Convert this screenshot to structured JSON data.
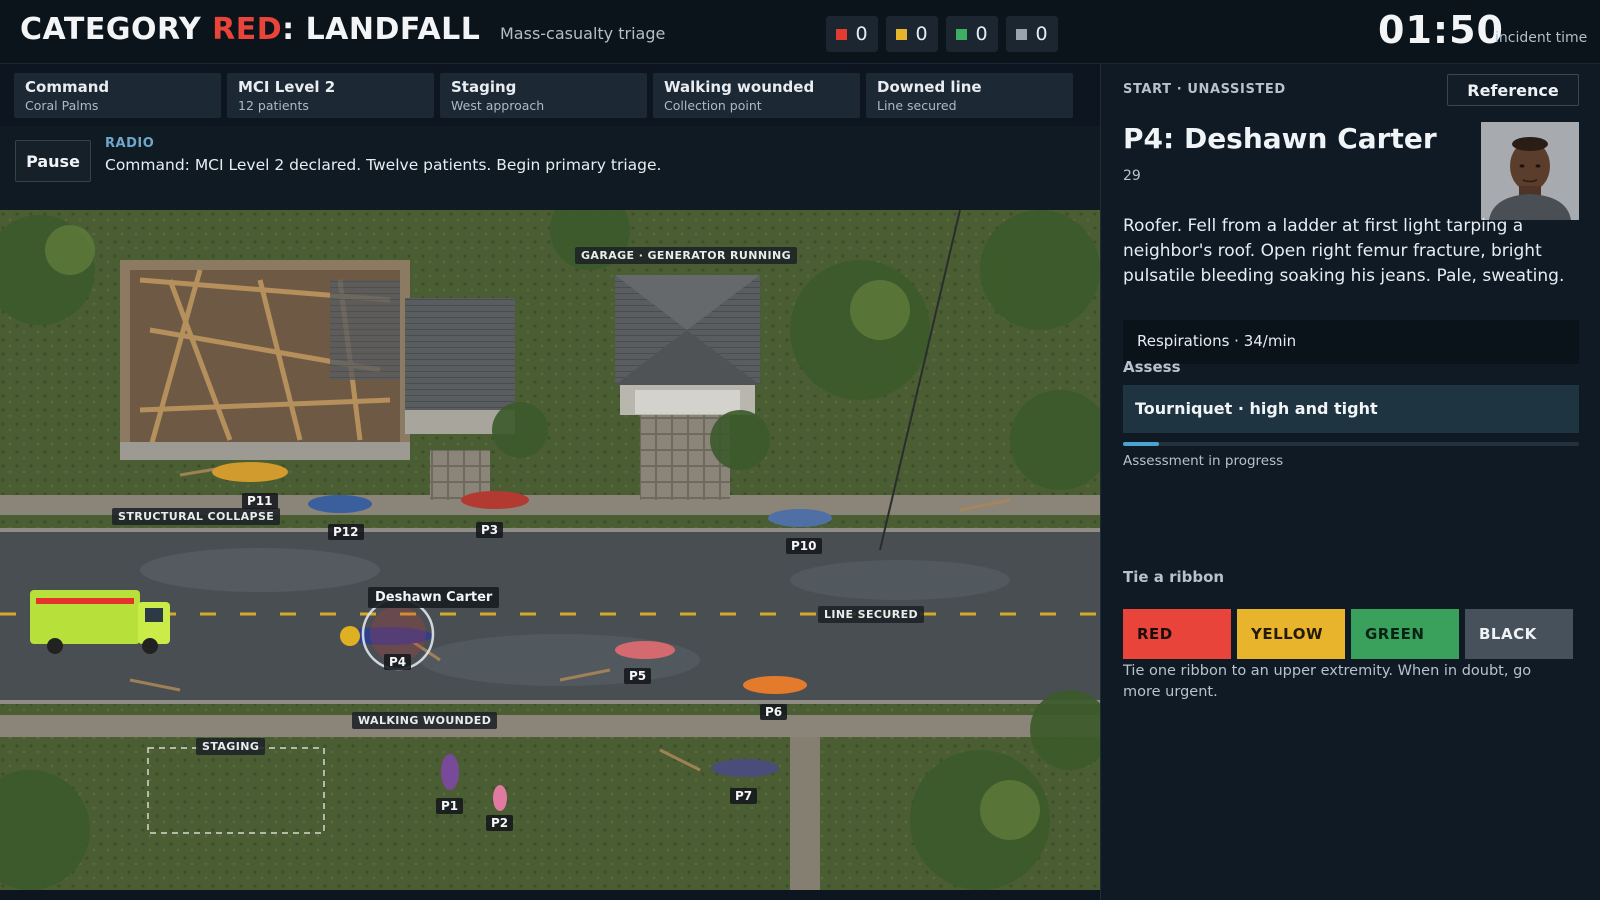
{
  "header": {
    "title_prefix": "CATEGORY ",
    "title_red": "RED",
    "title_suffix": ": LANDFALL",
    "subtitle": "Mass-casualty triage",
    "tallies": [
      {
        "color": "#e23c32",
        "count": "0"
      },
      {
        "color": "#e8b42c",
        "count": "0"
      },
      {
        "color": "#3fae62",
        "count": "0"
      },
      {
        "color": "#9ba4ad",
        "count": "0"
      }
    ],
    "clock": "01:50",
    "clock_label": "incident time"
  },
  "cards": [
    {
      "title": "Command",
      "sub": "Coral Palms"
    },
    {
      "title": "MCI Level 2",
      "sub": "12 patients"
    },
    {
      "title": "Staging",
      "sub": "West approach"
    },
    {
      "title": "Walking wounded",
      "sub": "Collection point"
    },
    {
      "title": "Downed line",
      "sub": "Line secured"
    }
  ],
  "radio": {
    "pause_label": "Pause",
    "label": "RADIO",
    "message": "Command: MCI Level 2 declared. Twelve patients. Begin primary triage."
  },
  "map": {
    "zones": {
      "garage": "GARAGE · GENERATOR RUNNING",
      "collapse": "STRUCTURAL COLLAPSE",
      "line": "LINE SECURED",
      "walking": "WALKING WOUNDED",
      "staging": "STAGING"
    },
    "focus_name": "Deshawn Carter",
    "patients": {
      "p1": "P1",
      "p2": "P2",
      "p3": "P3",
      "p4": "P4",
      "p5": "P5",
      "p6": "P6",
      "p7": "P7",
      "p10": "P10",
      "p11": "P11",
      "p12": "P12"
    }
  },
  "panel": {
    "protocol": "START · UNASSISTED",
    "reference_label": "Reference",
    "patient_name": "P4: Deshawn Carter",
    "patient_age": "29",
    "narrative": "Roofer. Fell from a ladder at first light tarping a neighbor's roof. Open right femur fracture, bright pulsatile bleeding soaking his jeans. Pale, sweating.",
    "vital": "Respirations · 34/min",
    "assess_label": "Assess",
    "assess_action": "Tourniquet · high and tight",
    "progress": 0.08,
    "progress_text": "Assessment in progress",
    "ribbon_label": "Tie a ribbon",
    "ribbons": [
      {
        "label": "RED",
        "bg": "#e8443a",
        "fg": "#1a0d0c"
      },
      {
        "label": "YELLOW",
        "bg": "#e8b42c",
        "fg": "#241a05"
      },
      {
        "label": "GREEN",
        "bg": "#3aa15c",
        "fg": "#082214"
      },
      {
        "label": "BLACK",
        "bg": "#46515c",
        "fg": "#eef2f5"
      }
    ],
    "ribbon_note": "Tie one ribbon to an upper extremity. When in doubt, go more urgent."
  }
}
